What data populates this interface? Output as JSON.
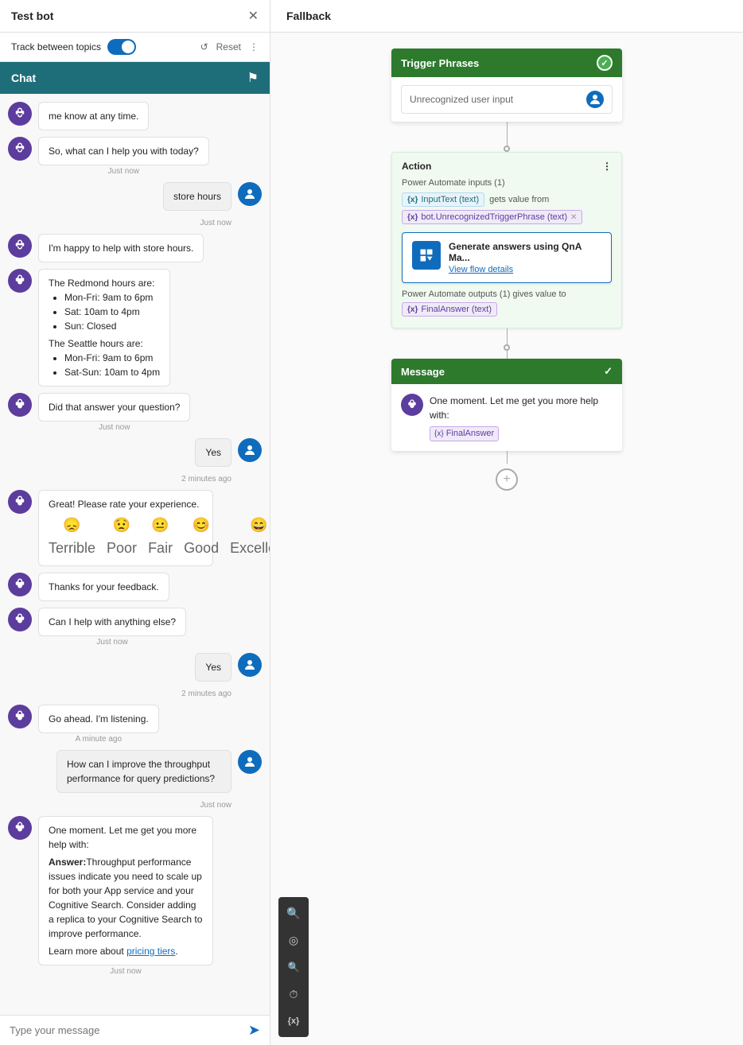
{
  "leftPanel": {
    "title": "Test bot",
    "toolbar": {
      "trackLabel": "Track between topics",
      "resetLabel": "Reset"
    },
    "chat": {
      "header": "Chat",
      "messages": [
        {
          "id": 1,
          "type": "bot",
          "text": "me know at any time.",
          "time": null
        },
        {
          "id": 2,
          "type": "bot",
          "text": "So, what can I help you with today?",
          "time": "Just now"
        },
        {
          "id": 3,
          "type": "user",
          "text": "store hours",
          "time": "Just now"
        },
        {
          "id": 4,
          "type": "bot",
          "text": "I'm happy to help with store hours.",
          "time": null
        },
        {
          "id": 5,
          "type": "bot-list",
          "text": "The Redmond hours are:",
          "items": [
            "Mon-Fri: 9am to 6pm",
            "Sat: 10am to 4pm",
            "Sun: Closed"
          ],
          "text2": "The Seattle hours are:",
          "items2": [
            "Mon-Fri: 9am to 6pm",
            "Sat-Sun: 10am to 4pm"
          ],
          "time": null
        },
        {
          "id": 6,
          "type": "bot",
          "text": "Did that answer your question?",
          "time": "Just now"
        },
        {
          "id": 7,
          "type": "user",
          "text": "Yes",
          "time": "2 minutes ago"
        },
        {
          "id": 8,
          "type": "bot",
          "text": "Great! Please rate your experience.",
          "time": null
        },
        {
          "id": 9,
          "type": "rating",
          "time": null
        },
        {
          "id": 10,
          "type": "bot",
          "text": "Thanks for your feedback.",
          "time": null
        },
        {
          "id": 11,
          "type": "bot",
          "text": "Can I help with anything else?",
          "time": "Just now"
        },
        {
          "id": 12,
          "type": "user",
          "text": "Yes",
          "time": "2 minutes ago"
        },
        {
          "id": 13,
          "type": "bot",
          "text": "Go ahead. I'm listening.",
          "time": "A minute ago"
        },
        {
          "id": 14,
          "type": "user",
          "text": "How can I improve the throughput performance for query predictions?",
          "time": "Just now"
        },
        {
          "id": 15,
          "type": "bot-answer",
          "intro": "One moment. Let me get you more help with:",
          "bold": "Answer:",
          "body": "Throughput performance issues indicate you need to scale up for both your App service and your Cognitive Search. Consider adding a replica to your Cognitive Search to improve performance.",
          "link": "Learn more about",
          "linkText": "pricing tiers",
          "time": "Just now"
        }
      ],
      "rating": {
        "items": [
          {
            "emoji": "😞",
            "label": "Terrible"
          },
          {
            "emoji": "😟",
            "label": "Poor"
          },
          {
            "emoji": "😐",
            "label": "Fair"
          },
          {
            "emoji": "😊",
            "label": "Good"
          },
          {
            "emoji": "😄",
            "label": "Excellent"
          }
        ]
      },
      "inputPlaceholder": "Type your message"
    }
  },
  "rightPanel": {
    "header": "Fallback",
    "triggerCard": {
      "title": "Trigger Phrases",
      "phraseLabel": "Unrecognized user input"
    },
    "actionCard": {
      "title": "Action",
      "inputsLabel": "Power Automate inputs (1)",
      "inputText": "InputText (text)",
      "getsValueFrom": "gets value from",
      "variableTag": "bot.UnrecognizedTriggerPhrase (text)",
      "generateTitle": "Generate answers using QnA Ma...",
      "generateLink": "View flow details",
      "outputsLabel": "Power Automate outputs (1) gives value to",
      "outputVar": "FinalAnswer (text)"
    },
    "messageCard": {
      "title": "Message",
      "text1": "One moment. Let me get you more help with:",
      "variable": "{x} FinalAnswer"
    }
  },
  "toolbar": {
    "icons": [
      "🔍",
      "◎",
      "🔍",
      "◷",
      "{x}"
    ]
  }
}
